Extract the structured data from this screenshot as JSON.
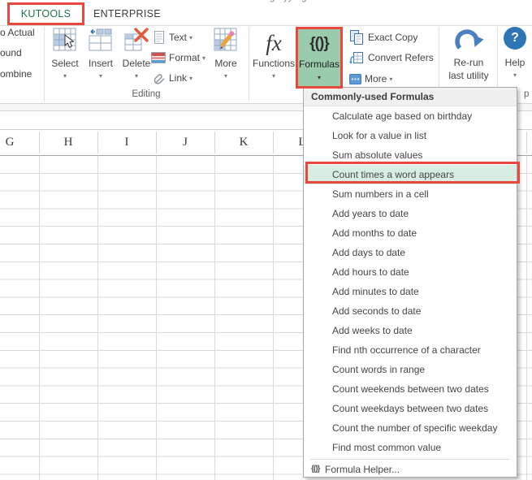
{
  "window": {
    "partial_title": "g yy g"
  },
  "tabs": {
    "kutools": "KUTOOLS",
    "enterprise": "ENTERPRISE"
  },
  "ribbon": {
    "left_partial_labels": [
      "o Actual",
      "ound",
      "ombine"
    ],
    "editing_group": {
      "label": "Editing",
      "select": "Select",
      "insert": "Insert",
      "delete": "Delete",
      "text": "Text",
      "format": "Format",
      "link": "Link",
      "more": "More"
    },
    "functions_button": {
      "label": "Functions",
      "icon_text": "fx"
    },
    "formulas_button": {
      "label": "Formulas",
      "icon_text": "{()}"
    },
    "utility_group": {
      "exact_copy": "Exact Copy",
      "convert_refers": "Convert Refers",
      "more": "More"
    },
    "rerun_button": {
      "line1": "Re-run",
      "line2": "last utility"
    },
    "help_button": {
      "label": "Help",
      "icon_text": "?"
    },
    "partial_group_label": "p"
  },
  "sheet": {
    "column_headers": [
      "G",
      "H",
      "I",
      "J",
      "K",
      "L"
    ]
  },
  "menu": {
    "header": "Commonly-used Formulas",
    "items": [
      "Calculate age based on birthday",
      "Look for a value in list",
      "Sum absolute values",
      "Count times a word appears",
      "Sum numbers in a cell",
      "Add years to date",
      "Add months to date",
      "Add days to date",
      "Add hours to date",
      "Add minutes to date",
      "Add seconds to date",
      "Add weeks to date",
      "Find nth occurrence of a character",
      "Count words in range",
      "Count weekends between two dates",
      "Count weekdays between two dates",
      "Count the number of specific weekday",
      "Find most common value"
    ],
    "highlighted_index": 3,
    "highlighted_item": "Count times a word appears",
    "footer_item": {
      "label": "Formula Helper...",
      "icon_text": "{()}"
    }
  },
  "colors": {
    "kutools_green": "#1e7145",
    "annotation_red": "#e8483e",
    "formulas_button_bg": "#9bcbad",
    "menu_highlight_bg": "#d9eee3",
    "icon_blue": "#2e75b6"
  }
}
